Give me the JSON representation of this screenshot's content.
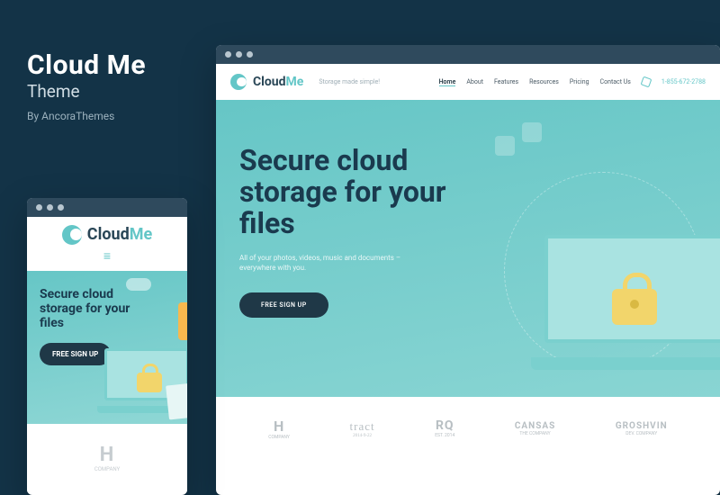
{
  "promo": {
    "title": "Cloud Me",
    "subtitle": "Theme",
    "byline": "By AncoraThemes"
  },
  "brand": {
    "name_first": "Cloud",
    "name_second": "Me",
    "tagline": "Storage made simple!"
  },
  "nav": {
    "items": [
      "Home",
      "About",
      "Features",
      "Resources",
      "Pricing",
      "Contact Us"
    ],
    "phone": "1-855-672-2788"
  },
  "hero": {
    "headline": "Secure cloud storage for your files",
    "sub": "All of your photos, videos, music and documents – everywhere with you.",
    "cta": "FREE SIGN UP"
  },
  "clients": {
    "h": {
      "label": "H",
      "sub": "COMPANY"
    },
    "tract": {
      "label": "tract",
      "sub": "2014-9-22"
    },
    "rq": {
      "label": "RQ",
      "sub": "EST. 2014"
    },
    "cansas": {
      "label": "CANSAS",
      "sub": "THE COMPANY"
    },
    "groshvin": {
      "label": "GROSHVIN",
      "sub": "DEV. COMPANY"
    }
  }
}
